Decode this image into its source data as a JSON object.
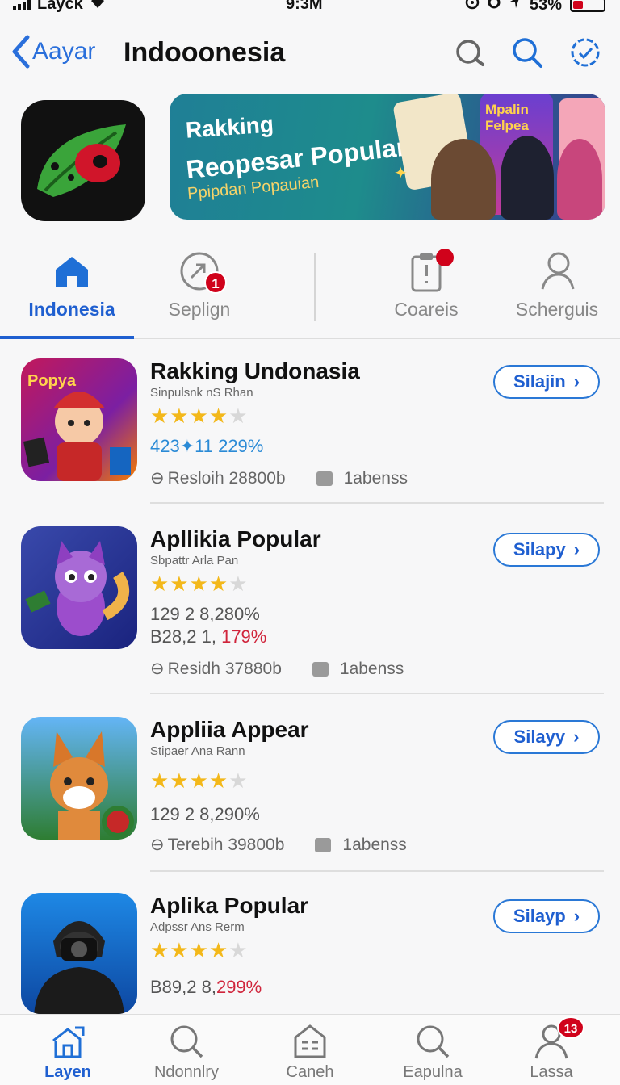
{
  "status": {
    "carrier": "Layck",
    "time": "9:3M",
    "battery": "53%"
  },
  "nav": {
    "back_label": "Aayar",
    "title": "Indooonesia"
  },
  "banner": {
    "line1": "Rakking",
    "line2": "Reopesar Popular",
    "line3": "Ppipdan Popauian",
    "card1": "Mpalin Felpea"
  },
  "tabs": [
    {
      "label": "Indonesia",
      "icon": "home-icon",
      "active": true
    },
    {
      "label": "Seplign",
      "icon": "share-icon",
      "badge": "1"
    },
    {
      "label": "Coareis",
      "icon": "clipboard-icon",
      "dot": true
    },
    {
      "label": "Scherguis",
      "icon": "person-icon"
    }
  ],
  "apps": [
    {
      "name": "Rakking Undonasia",
      "subtitle": "Sinpulsnk nS Rhan",
      "rating": 4.5,
      "stat1": "423✦11 229%",
      "stat2": "",
      "meta1": "Resloih 28800b",
      "meta2": "1abenss",
      "button": "Silajin"
    },
    {
      "name": "Apllikia Popular",
      "subtitle": "Sbpattr Arla Pan",
      "rating": 4.5,
      "stat1": "129 2 8,280%",
      "stat2a": "B28,2 1, ",
      "stat2b": "179%",
      "meta1": "Residh 37880b",
      "meta2": "1abenss",
      "button": "Silapy"
    },
    {
      "name": "Appliia Appear",
      "subtitle": "Stipaer Ana Rann",
      "rating": 4.5,
      "stat1": "129 2 8,290%",
      "stat2": "",
      "meta1": "Terebih 39800b",
      "meta2": "1abenss",
      "button": "Silayy"
    },
    {
      "name": "Aplika Popular",
      "subtitle": "Adpssr Ans Rerm",
      "rating": 4.5,
      "stat1a": "B89,2 8,",
      "stat1b": "299%",
      "button": "Silayp"
    }
  ],
  "bottom_tabs": [
    {
      "label": "Layen",
      "icon": "home-icon",
      "active": true
    },
    {
      "label": "Ndonnlry",
      "icon": "search-icon"
    },
    {
      "label": "Caneh",
      "icon": "building-icon"
    },
    {
      "label": "Eapulna",
      "icon": "search-icon"
    },
    {
      "label": "Lassa",
      "icon": "person-icon",
      "badge": "13"
    }
  ],
  "colors": {
    "accent": "#1f5fd0",
    "badge": "#d0021b",
    "star": "#f3b81a"
  }
}
